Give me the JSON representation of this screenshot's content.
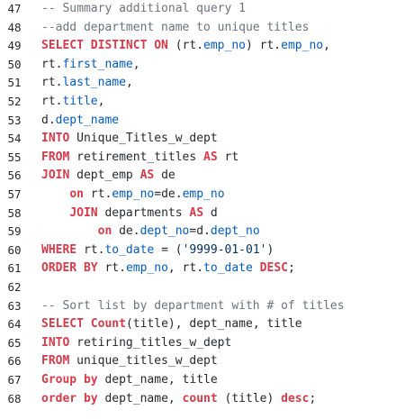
{
  "colors": {
    "keyword": "#d73a49",
    "comment": "#6a737d",
    "string": "#032f62",
    "property": "#005cc5",
    "text": "#24292e",
    "background": "#ffffff"
  },
  "lines": [
    {
      "num": "47",
      "tokens": [
        [
          "c",
          "-- Summary additional query 1"
        ]
      ]
    },
    {
      "num": "48",
      "tokens": [
        [
          "c",
          "--add department name to unique titles"
        ]
      ]
    },
    {
      "num": "49",
      "tokens": [
        [
          "k",
          "SELECT DISTINCT ON"
        ],
        [
          "t",
          " (rt."
        ],
        [
          "p",
          "emp_no"
        ],
        [
          "t",
          ") rt."
        ],
        [
          "p",
          "emp_no"
        ],
        [
          "t",
          ","
        ]
      ]
    },
    {
      "num": "50",
      "tokens": [
        [
          "t",
          "rt."
        ],
        [
          "p",
          "first_name"
        ],
        [
          "t",
          ","
        ]
      ]
    },
    {
      "num": "51",
      "tokens": [
        [
          "t",
          "rt."
        ],
        [
          "p",
          "last_name"
        ],
        [
          "t",
          ","
        ]
      ]
    },
    {
      "num": "52",
      "tokens": [
        [
          "t",
          "rt."
        ],
        [
          "p",
          "title"
        ],
        [
          "t",
          ","
        ]
      ]
    },
    {
      "num": "53",
      "tokens": [
        [
          "t",
          "d."
        ],
        [
          "p",
          "dept_name"
        ]
      ]
    },
    {
      "num": "54",
      "tokens": [
        [
          "k",
          "INTO"
        ],
        [
          "t",
          " Unique_Titles_w_dept"
        ]
      ]
    },
    {
      "num": "55",
      "tokens": [
        [
          "k",
          "FROM"
        ],
        [
          "t",
          " retirement_titles "
        ],
        [
          "k",
          "AS"
        ],
        [
          "t",
          " rt"
        ]
      ]
    },
    {
      "num": "56",
      "tokens": [
        [
          "k",
          "JOIN"
        ],
        [
          "t",
          " dept_emp "
        ],
        [
          "k",
          "AS"
        ],
        [
          "t",
          " de"
        ]
      ]
    },
    {
      "num": "57",
      "tokens": [
        [
          "t",
          "    "
        ],
        [
          "k",
          "on"
        ],
        [
          "t",
          " rt."
        ],
        [
          "p",
          "emp_no"
        ],
        [
          "t",
          "=de."
        ],
        [
          "p",
          "emp_no"
        ]
      ]
    },
    {
      "num": "58",
      "tokens": [
        [
          "t",
          "    "
        ],
        [
          "k",
          "JOIN"
        ],
        [
          "t",
          " departments "
        ],
        [
          "k",
          "AS"
        ],
        [
          "t",
          " d"
        ]
      ]
    },
    {
      "num": "59",
      "tokens": [
        [
          "t",
          "        "
        ],
        [
          "k",
          "on"
        ],
        [
          "t",
          " de."
        ],
        [
          "p",
          "dept_no"
        ],
        [
          "t",
          "=d."
        ],
        [
          "p",
          "dept_no"
        ]
      ]
    },
    {
      "num": "60",
      "tokens": [
        [
          "k",
          "WHERE"
        ],
        [
          "t",
          " rt."
        ],
        [
          "p",
          "to_date"
        ],
        [
          "t",
          " = ("
        ],
        [
          "s",
          "'9999-01-01'"
        ],
        [
          "t",
          ")"
        ]
      ]
    },
    {
      "num": "61",
      "tokens": [
        [
          "k",
          "ORDER BY"
        ],
        [
          "t",
          " rt."
        ],
        [
          "p",
          "emp_no"
        ],
        [
          "t",
          ", rt."
        ],
        [
          "p",
          "to_date"
        ],
        [
          "t",
          " "
        ],
        [
          "k",
          "DESC"
        ],
        [
          "t",
          ";"
        ]
      ]
    },
    {
      "num": "62",
      "tokens": []
    },
    {
      "num": "63",
      "tokens": [
        [
          "c",
          "-- Sort list by department with # of titles"
        ]
      ]
    },
    {
      "num": "64",
      "tokens": [
        [
          "k",
          "SELECT"
        ],
        [
          "t",
          " "
        ],
        [
          "k",
          "Count"
        ],
        [
          "t",
          "(title), dept_name, title"
        ]
      ]
    },
    {
      "num": "65",
      "tokens": [
        [
          "k",
          "INTO"
        ],
        [
          "t",
          " retiring_titles_w_dept"
        ]
      ]
    },
    {
      "num": "66",
      "tokens": [
        [
          "k",
          "FROM"
        ],
        [
          "t",
          " unique_titles_w_dept"
        ]
      ]
    },
    {
      "num": "67",
      "tokens": [
        [
          "k",
          "Group by"
        ],
        [
          "t",
          " dept_name, title"
        ]
      ]
    },
    {
      "num": "68",
      "tokens": [
        [
          "k",
          "order by"
        ],
        [
          "t",
          " dept_name, "
        ],
        [
          "k",
          "count"
        ],
        [
          "t",
          " (title) "
        ],
        [
          "k",
          "desc"
        ],
        [
          "t",
          ";"
        ]
      ]
    }
  ]
}
